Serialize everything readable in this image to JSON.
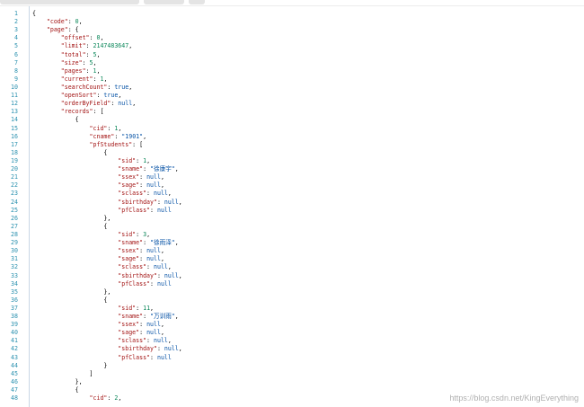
{
  "editor": {
    "lines": [
      [
        [
          "pn",
          "{"
        ]
      ],
      [
        [
          "pn",
          "    "
        ],
        [
          "key",
          "\"code\""
        ],
        [
          "pn",
          ": "
        ],
        [
          "num",
          "0"
        ],
        [
          "pn",
          ","
        ]
      ],
      [
        [
          "pn",
          "    "
        ],
        [
          "key",
          "\"page\""
        ],
        [
          "pn",
          ": {"
        ]
      ],
      [
        [
          "pn",
          "        "
        ],
        [
          "key",
          "\"offset\""
        ],
        [
          "pn",
          ": "
        ],
        [
          "num",
          "0"
        ],
        [
          "pn",
          ","
        ]
      ],
      [
        [
          "pn",
          "        "
        ],
        [
          "key",
          "\"limit\""
        ],
        [
          "pn",
          ": "
        ],
        [
          "num",
          "2147483647"
        ],
        [
          "pn",
          ","
        ]
      ],
      [
        [
          "pn",
          "        "
        ],
        [
          "key",
          "\"total\""
        ],
        [
          "pn",
          ": "
        ],
        [
          "num",
          "5"
        ],
        [
          "pn",
          ","
        ]
      ],
      [
        [
          "pn",
          "        "
        ],
        [
          "key",
          "\"size\""
        ],
        [
          "pn",
          ": "
        ],
        [
          "num",
          "5"
        ],
        [
          "pn",
          ","
        ]
      ],
      [
        [
          "pn",
          "        "
        ],
        [
          "key",
          "\"pages\""
        ],
        [
          "pn",
          ": "
        ],
        [
          "num",
          "1"
        ],
        [
          "pn",
          ","
        ]
      ],
      [
        [
          "pn",
          "        "
        ],
        [
          "key",
          "\"current\""
        ],
        [
          "pn",
          ": "
        ],
        [
          "num",
          "1"
        ],
        [
          "pn",
          ","
        ]
      ],
      [
        [
          "pn",
          "        "
        ],
        [
          "key",
          "\"searchCount\""
        ],
        [
          "pn",
          ": "
        ],
        [
          "kw",
          "true"
        ],
        [
          "pn",
          ","
        ]
      ],
      [
        [
          "pn",
          "        "
        ],
        [
          "key",
          "\"openSort\""
        ],
        [
          "pn",
          ": "
        ],
        [
          "kw",
          "true"
        ],
        [
          "pn",
          ","
        ]
      ],
      [
        [
          "pn",
          "        "
        ],
        [
          "key",
          "\"orderByField\""
        ],
        [
          "pn",
          ": "
        ],
        [
          "kw",
          "null"
        ],
        [
          "pn",
          ","
        ]
      ],
      [
        [
          "pn",
          "        "
        ],
        [
          "key",
          "\"records\""
        ],
        [
          "pn",
          ": ["
        ]
      ],
      [
        [
          "pn",
          "            {"
        ]
      ],
      [
        [
          "pn",
          "                "
        ],
        [
          "key",
          "\"cid\""
        ],
        [
          "pn",
          ": "
        ],
        [
          "num",
          "1"
        ],
        [
          "pn",
          ","
        ]
      ],
      [
        [
          "pn",
          "                "
        ],
        [
          "key",
          "\"cname\""
        ],
        [
          "pn",
          ": "
        ],
        [
          "str",
          "\"1901\""
        ],
        [
          "pn",
          ","
        ]
      ],
      [
        [
          "pn",
          "                "
        ],
        [
          "key",
          "\"pfStudents\""
        ],
        [
          "pn",
          ": ["
        ]
      ],
      [
        [
          "pn",
          "                    {"
        ]
      ],
      [
        [
          "pn",
          "                        "
        ],
        [
          "key",
          "\"sid\""
        ],
        [
          "pn",
          ": "
        ],
        [
          "num",
          "1"
        ],
        [
          "pn",
          ","
        ]
      ],
      [
        [
          "pn",
          "                        "
        ],
        [
          "key",
          "\"sname\""
        ],
        [
          "pn",
          ": "
        ],
        [
          "str",
          "\"徐康宇\""
        ],
        [
          "pn",
          ","
        ]
      ],
      [
        [
          "pn",
          "                        "
        ],
        [
          "key",
          "\"ssex\""
        ],
        [
          "pn",
          ": "
        ],
        [
          "kw",
          "null"
        ],
        [
          "pn",
          ","
        ]
      ],
      [
        [
          "pn",
          "                        "
        ],
        [
          "key",
          "\"sage\""
        ],
        [
          "pn",
          ": "
        ],
        [
          "kw",
          "null"
        ],
        [
          "pn",
          ","
        ]
      ],
      [
        [
          "pn",
          "                        "
        ],
        [
          "key",
          "\"sclass\""
        ],
        [
          "pn",
          ": "
        ],
        [
          "kw",
          "null"
        ],
        [
          "pn",
          ","
        ]
      ],
      [
        [
          "pn",
          "                        "
        ],
        [
          "key",
          "\"sbirthday\""
        ],
        [
          "pn",
          ": "
        ],
        [
          "kw",
          "null"
        ],
        [
          "pn",
          ","
        ]
      ],
      [
        [
          "pn",
          "                        "
        ],
        [
          "key",
          "\"pfClass\""
        ],
        [
          "pn",
          ": "
        ],
        [
          "kw",
          "null"
        ]
      ],
      [
        [
          "pn",
          "                    },"
        ]
      ],
      [
        [
          "pn",
          "                    {"
        ]
      ],
      [
        [
          "pn",
          "                        "
        ],
        [
          "key",
          "\"sid\""
        ],
        [
          "pn",
          ": "
        ],
        [
          "num",
          "3"
        ],
        [
          "pn",
          ","
        ]
      ],
      [
        [
          "pn",
          "                        "
        ],
        [
          "key",
          "\"sname\""
        ],
        [
          "pn",
          ": "
        ],
        [
          "str",
          "\"徐雨泽\""
        ],
        [
          "pn",
          ","
        ]
      ],
      [
        [
          "pn",
          "                        "
        ],
        [
          "key",
          "\"ssex\""
        ],
        [
          "pn",
          ": "
        ],
        [
          "kw",
          "null"
        ],
        [
          "pn",
          ","
        ]
      ],
      [
        [
          "pn",
          "                        "
        ],
        [
          "key",
          "\"sage\""
        ],
        [
          "pn",
          ": "
        ],
        [
          "kw",
          "null"
        ],
        [
          "pn",
          ","
        ]
      ],
      [
        [
          "pn",
          "                        "
        ],
        [
          "key",
          "\"sclass\""
        ],
        [
          "pn",
          ": "
        ],
        [
          "kw",
          "null"
        ],
        [
          "pn",
          ","
        ]
      ],
      [
        [
          "pn",
          "                        "
        ],
        [
          "key",
          "\"sbirthday\""
        ],
        [
          "pn",
          ": "
        ],
        [
          "kw",
          "null"
        ],
        [
          "pn",
          ","
        ]
      ],
      [
        [
          "pn",
          "                        "
        ],
        [
          "key",
          "\"pfClass\""
        ],
        [
          "pn",
          ": "
        ],
        [
          "kw",
          "null"
        ]
      ],
      [
        [
          "pn",
          "                    },"
        ]
      ],
      [
        [
          "pn",
          "                    {"
        ]
      ],
      [
        [
          "pn",
          "                        "
        ],
        [
          "key",
          "\"sid\""
        ],
        [
          "pn",
          ": "
        ],
        [
          "num",
          "11"
        ],
        [
          "pn",
          ","
        ]
      ],
      [
        [
          "pn",
          "                        "
        ],
        [
          "key",
          "\"sname\""
        ],
        [
          "pn",
          ": "
        ],
        [
          "str",
          "\"万训雨\""
        ],
        [
          "pn",
          ","
        ]
      ],
      [
        [
          "pn",
          "                        "
        ],
        [
          "key",
          "\"ssex\""
        ],
        [
          "pn",
          ": "
        ],
        [
          "kw",
          "null"
        ],
        [
          "pn",
          ","
        ]
      ],
      [
        [
          "pn",
          "                        "
        ],
        [
          "key",
          "\"sage\""
        ],
        [
          "pn",
          ": "
        ],
        [
          "kw",
          "null"
        ],
        [
          "pn",
          ","
        ]
      ],
      [
        [
          "pn",
          "                        "
        ],
        [
          "key",
          "\"sclass\""
        ],
        [
          "pn",
          ": "
        ],
        [
          "kw",
          "null"
        ],
        [
          "pn",
          ","
        ]
      ],
      [
        [
          "pn",
          "                        "
        ],
        [
          "key",
          "\"sbirthday\""
        ],
        [
          "pn",
          ": "
        ],
        [
          "kw",
          "null"
        ],
        [
          "pn",
          ","
        ]
      ],
      [
        [
          "pn",
          "                        "
        ],
        [
          "key",
          "\"pfClass\""
        ],
        [
          "pn",
          ": "
        ],
        [
          "kw",
          "null"
        ]
      ],
      [
        [
          "pn",
          "                    }"
        ]
      ],
      [
        [
          "pn",
          "                ]"
        ]
      ],
      [
        [
          "pn",
          "            },"
        ]
      ],
      [
        [
          "pn",
          "            {"
        ]
      ],
      [
        [
          "pn",
          "                "
        ],
        [
          "key",
          "\"cid\""
        ],
        [
          "pn",
          ": "
        ],
        [
          "num",
          "2"
        ],
        [
          "pn",
          ","
        ]
      ]
    ]
  },
  "watermark": "https://blog.csdn.net/KingEverything",
  "colors": {
    "line_number": "#2b91af",
    "key": "#a31515",
    "string": "#0451a5",
    "number": "#098658",
    "keyword": "#0451a5"
  }
}
